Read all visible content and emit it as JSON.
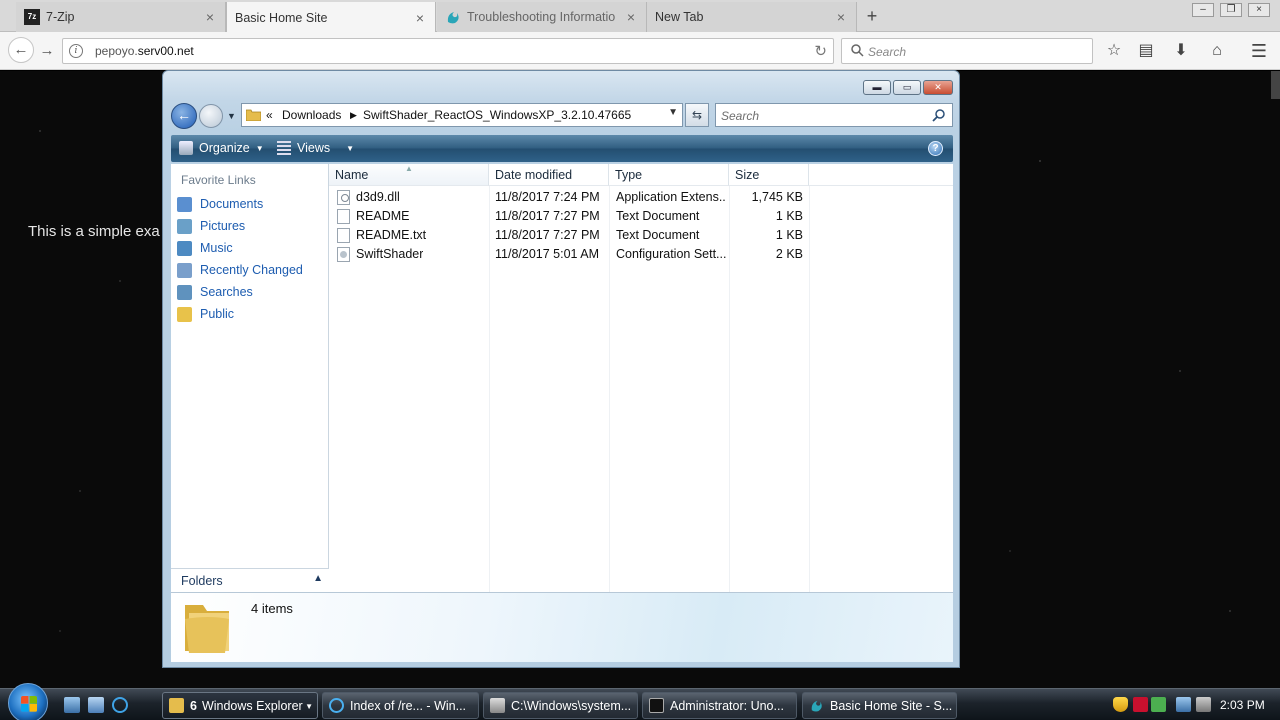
{
  "browser": {
    "tabs": [
      {
        "title": "7-Zip",
        "active": false
      },
      {
        "title": "Basic Home Site",
        "active": true
      },
      {
        "title": "Troubleshooting Informatio",
        "active": false
      },
      {
        "title": "New Tab",
        "active": false
      }
    ],
    "newtab_symbol": "+",
    "url_plain": "pepoyo.",
    "url_domain": "serv00.net",
    "search_placeholder": "Search"
  },
  "page": {
    "text": "This is a simple exa"
  },
  "explorer": {
    "breadcrumb_prefix": "«",
    "breadcrumb": [
      "Downloads",
      "SwiftShader_ReactOS_WindowsXP_3.2.10.47665"
    ],
    "search_placeholder": "Search",
    "commands": {
      "organize": "Organize",
      "views": "Views"
    },
    "favorites_header": "Favorite Links",
    "favorites": [
      {
        "label": "Documents",
        "color": "#5a8fd0"
      },
      {
        "label": "Pictures",
        "color": "#6aa0c8"
      },
      {
        "label": "Music",
        "color": "#4d8ac2"
      },
      {
        "label": "Recently Changed",
        "color": "#7a9fcb"
      },
      {
        "label": "Searches",
        "color": "#5f92be"
      },
      {
        "label": "Public",
        "color": "#e8c24a"
      }
    ],
    "folders_label": "Folders",
    "columns": [
      "Name",
      "Date modified",
      "Type",
      "Size"
    ],
    "files": [
      {
        "name": "d3d9.dll",
        "date": "11/8/2017 7:24 PM",
        "type": "Application Extens...",
        "size": "1,745 KB",
        "icon": "dll"
      },
      {
        "name": "README",
        "date": "11/8/2017 7:27 PM",
        "type": "Text Document",
        "size": "1 KB",
        "icon": "txt"
      },
      {
        "name": "README.txt",
        "date": "11/8/2017 7:27 PM",
        "type": "Text Document",
        "size": "1 KB",
        "icon": "txt"
      },
      {
        "name": "SwiftShader",
        "date": "11/8/2017 5:01 AM",
        "type": "Configuration Sett...",
        "size": "2 KB",
        "icon": "cfg"
      }
    ],
    "item_count": "4 items"
  },
  "taskbar": {
    "buttons": [
      {
        "count": "6",
        "label": "Windows Explorer"
      },
      {
        "label": "Index of /re... - Win..."
      },
      {
        "label": "C:\\Windows\\system..."
      },
      {
        "label": "Administrator:  Uno..."
      },
      {
        "label": "Basic Home Site - S..."
      }
    ],
    "clock": "2:03 PM"
  }
}
